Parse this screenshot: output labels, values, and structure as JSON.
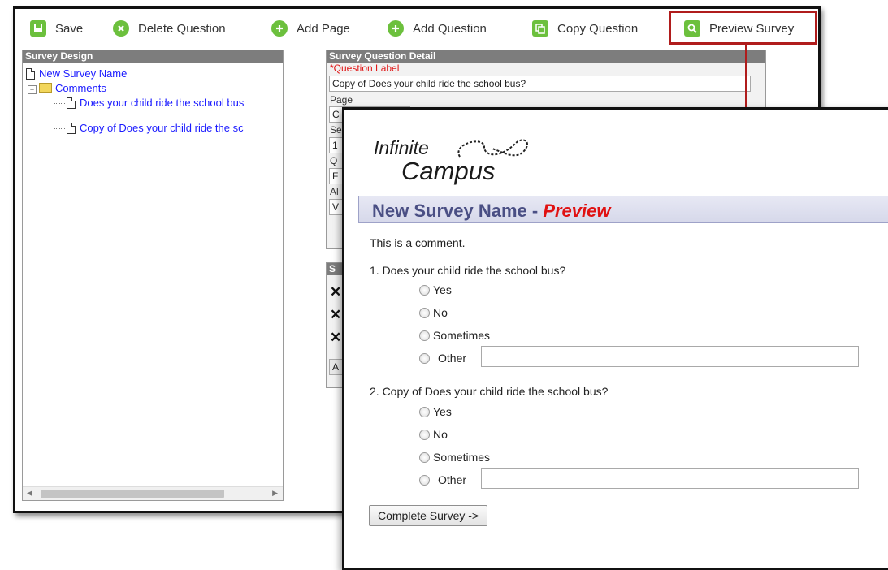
{
  "toolbar": {
    "save": "Save",
    "delete_question": "Delete Question",
    "add_page": "Add Page",
    "add_question": "Add Question",
    "copy_question": "Copy Question",
    "preview_survey": "Preview Survey"
  },
  "survey_design": {
    "header": "Survey Design",
    "root": "New Survey Name",
    "folder": "Comments",
    "items": [
      "Does your child ride the school bus",
      "Copy of Does your child ride the sc"
    ]
  },
  "question_detail": {
    "header": "Survey Question Detail",
    "label_field": "*Question Label",
    "label_value": "Copy of Does your child ride the school bus?",
    "page_label": "Page",
    "page_value": "C",
    "se_label": "Se",
    "se_value": "1",
    "q_label": "Q",
    "q_value": "F",
    "al_label": "Al",
    "al_value": "V",
    "second_header": "S",
    "second_button": "A"
  },
  "preview": {
    "logo_line1": "Infinite",
    "logo_line2": "Campus",
    "title": "New Survey Name - ",
    "title_accent": "Preview",
    "comment": "This is a comment.",
    "questions": [
      {
        "text": "1.  Does your child ride the school bus?",
        "options": [
          "Yes",
          "No",
          "Sometimes",
          "Other"
        ]
      },
      {
        "text": "2.  Copy of Does your child ride the school bus?",
        "options": [
          "Yes",
          "No",
          "Sometimes",
          "Other"
        ]
      }
    ],
    "complete_button": "Complete Survey ->"
  },
  "colors": {
    "accent_green": "#6cc03d",
    "highlight_red": "#b01c1c",
    "title_blue": "#4a4f84",
    "preview_red": "#e01212",
    "link_blue": "#1a1aff"
  }
}
